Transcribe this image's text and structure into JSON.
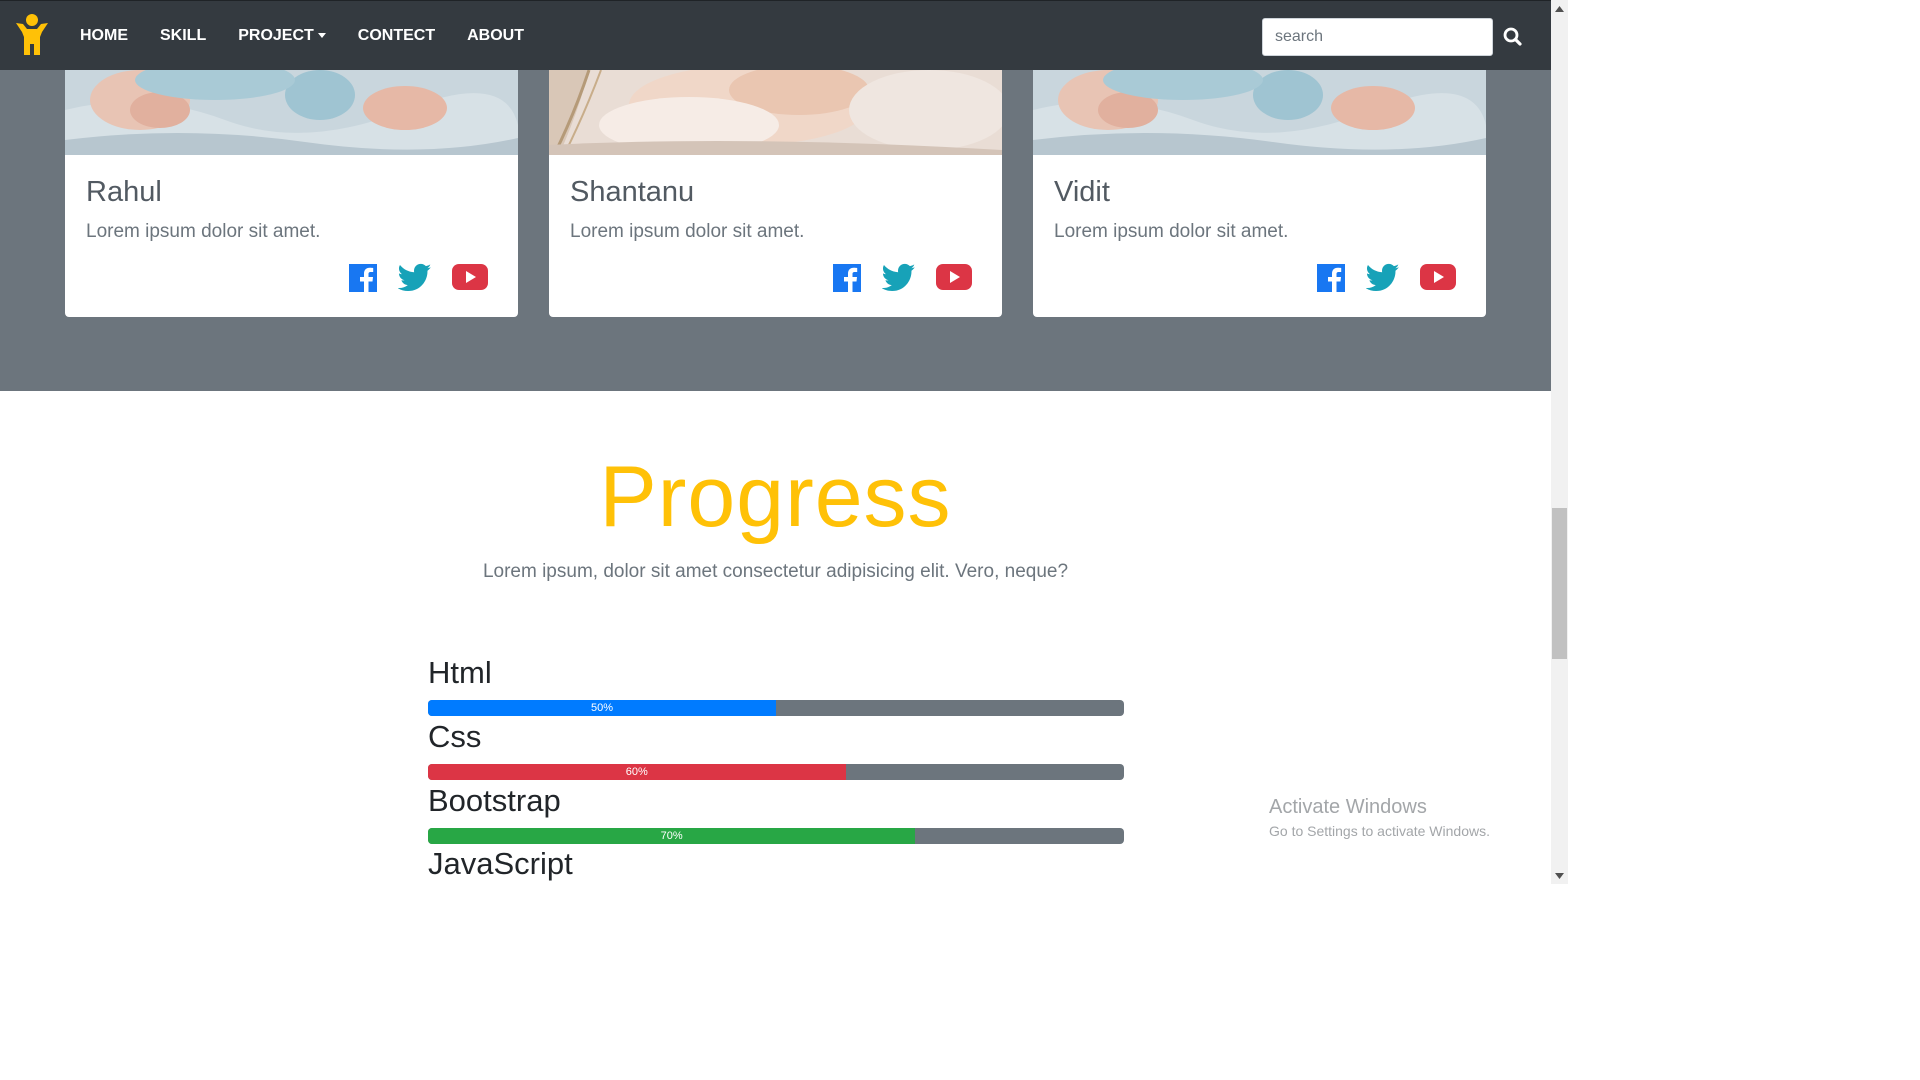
{
  "navbar": {
    "brand_icon": "person-logo-icon",
    "links": [
      {
        "label": "HOME"
      },
      {
        "label": "SKILL"
      },
      {
        "label": "PROJECT"
      },
      {
        "label": "CONTECT"
      },
      {
        "label": "ABOUT"
      }
    ],
    "search_placeholder": "search",
    "search_icon": "search-icon",
    "colors": {
      "bg": "#343a40",
      "brand": "#ffc107"
    }
  },
  "team": {
    "cards": [
      {
        "name": "Rahul",
        "text": "Lorem ipsum dolor sit amet."
      },
      {
        "name": "Shantanu",
        "text": "Lorem ipsum dolor sit amet."
      },
      {
        "name": "Vidit",
        "text": "Lorem ipsum dolor sit amet."
      }
    ],
    "social_icons": [
      "facebook-icon",
      "twitter-icon",
      "youtube-icon"
    ],
    "section_bg": "#6c757d"
  },
  "progress": {
    "title": "Progress",
    "subtitle": "Lorem ipsum, dolor sit amet consectetur adipisicing elit. Vero, neque?",
    "skills": [
      {
        "label": "Html",
        "percent": 50,
        "percent_text": "50%",
        "color": "#007bff"
      },
      {
        "label": "Css",
        "percent": 60,
        "percent_text": "60%",
        "color": "#dc3545"
      },
      {
        "label": "Bootstrap",
        "percent": 70,
        "percent_text": "70%",
        "color": "#28a745"
      },
      {
        "label": "JavaScript"
      }
    ],
    "title_color": "#ffc107"
  },
  "watermark": {
    "title": "Activate Windows",
    "subtitle": "Go to Settings to activate Windows."
  }
}
